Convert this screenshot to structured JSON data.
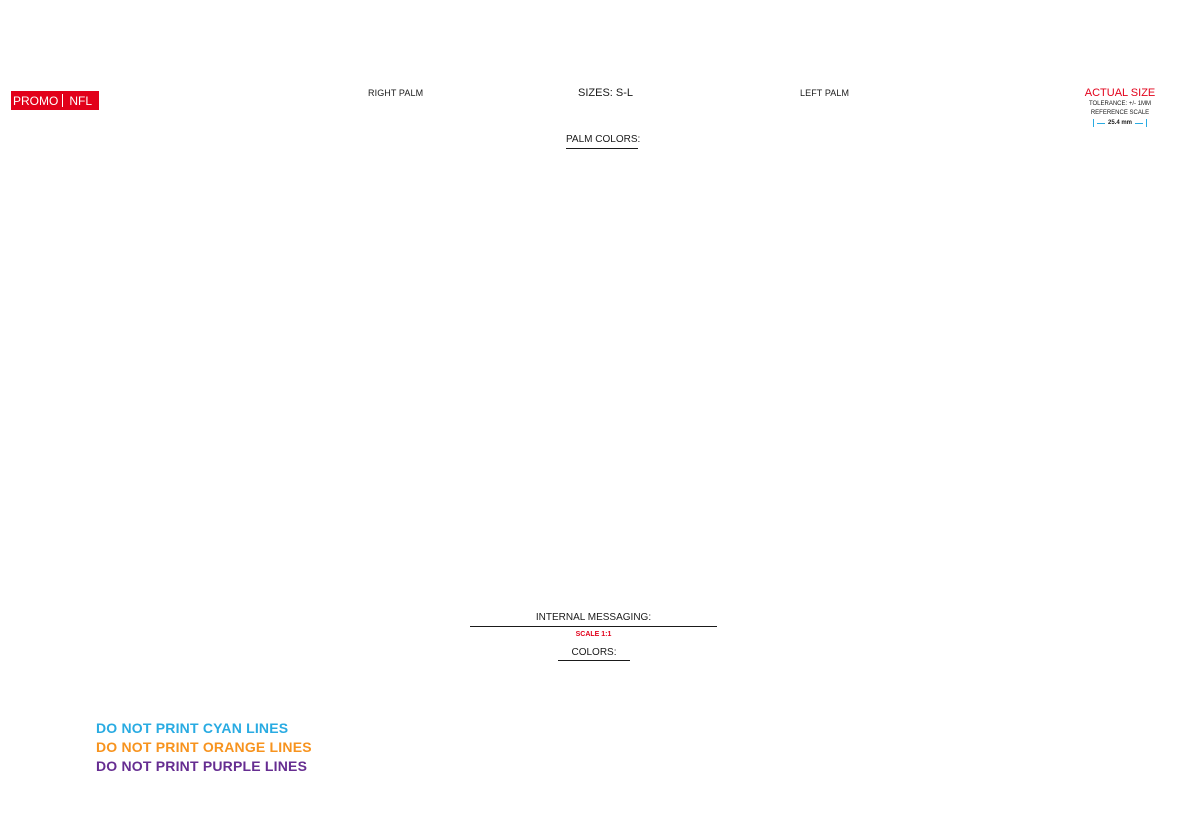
{
  "brand": {
    "left": "PROMO",
    "right": "NFL",
    "color": "#e2001a"
  },
  "header": {
    "right_palm": "RIGHT PALM",
    "sizes": "SIZES: S-L",
    "left_palm": "LEFT PALM",
    "palm_colors": "PALM COLORS:"
  },
  "reference": {
    "actual_size": "ACTUAL SIZE",
    "tolerance": "TOLERANCE: +/- 1MM",
    "reference_scale": "REFERENCE SCALE",
    "scale_value": "25.4 mm"
  },
  "footer": {
    "internal_messaging": "INTERNAL MESSAGING:",
    "scale": "SCALE 1:1",
    "colors": "COLORS:"
  },
  "warnings": {
    "cyan": "DO NOT PRINT CYAN LINES",
    "orange": "DO NOT PRINT ORANGE LINES",
    "purple": "DO NOT PRINT PURPLE LINES"
  },
  "colors": {
    "red": "#e2001a",
    "cyan": "#29abe2",
    "orange": "#f7931e",
    "purple": "#662d91"
  }
}
